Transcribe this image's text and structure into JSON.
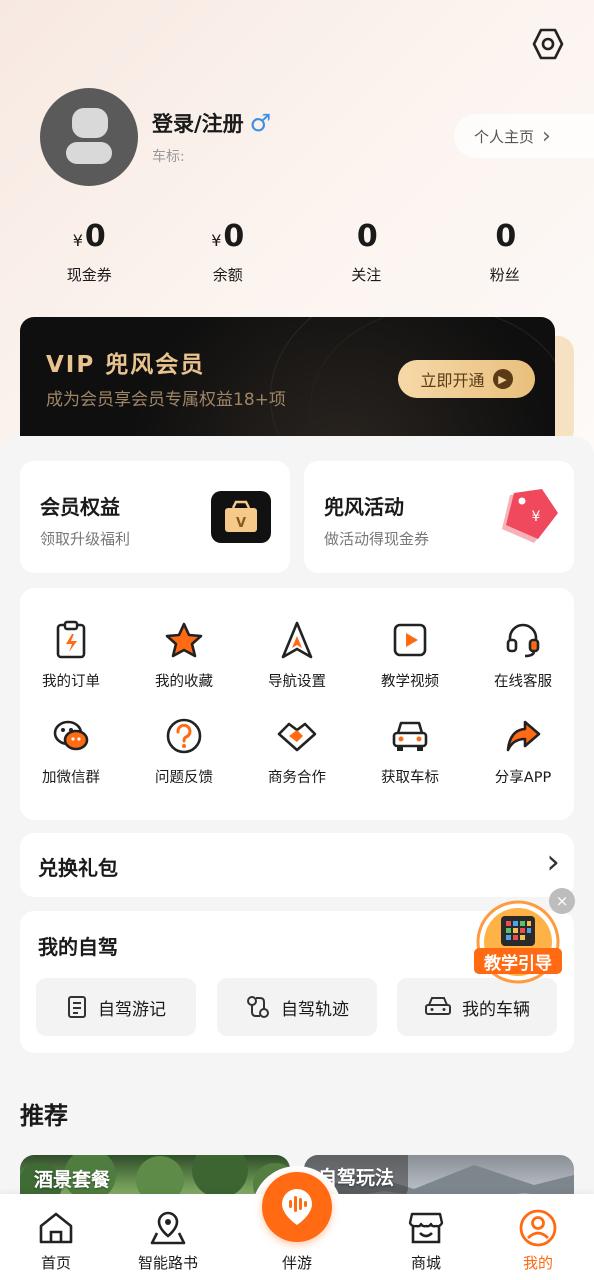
{
  "profile": {
    "login_label": "登录/注册",
    "gender_symbol": "♂",
    "car_badge_label": "车标:",
    "homepage_label": "个人主页",
    "homepage_arrow": "›"
  },
  "stats": [
    {
      "currency": "¥",
      "value": "0",
      "label": "现金券"
    },
    {
      "currency": "¥",
      "value": "0",
      "label": "余额"
    },
    {
      "currency": "",
      "value": "0",
      "label": "关注"
    },
    {
      "currency": "",
      "value": "0",
      "label": "粉丝"
    }
  ],
  "vip": {
    "title": "VIP 兜风会员",
    "subtitle": "成为会员享会员专属权益18+项",
    "button": "立即开通"
  },
  "feature_cards": [
    {
      "title": "会员权益",
      "subtitle": "领取升级福利"
    },
    {
      "title": "兜风活动",
      "subtitle": "做活动得现金券"
    }
  ],
  "tools": [
    {
      "label": "我的订单",
      "icon": "order-icon"
    },
    {
      "label": "我的收藏",
      "icon": "star-icon"
    },
    {
      "label": "导航设置",
      "icon": "navigation-icon"
    },
    {
      "label": "教学视频",
      "icon": "video-icon"
    },
    {
      "label": "在线客服",
      "icon": "headset-icon"
    },
    {
      "label": "加微信群",
      "icon": "wechat-icon"
    },
    {
      "label": "问题反馈",
      "icon": "question-icon"
    },
    {
      "label": "商务合作",
      "icon": "handshake-icon"
    },
    {
      "label": "获取车标",
      "icon": "car-icon"
    },
    {
      "label": "分享APP",
      "icon": "share-icon"
    }
  ],
  "exchange": {
    "label": "兑换礼包",
    "arrow": "›"
  },
  "self_drive": {
    "title": "我的自驾",
    "buttons": [
      {
        "label": "自驾游记",
        "icon": "journal-icon"
      },
      {
        "label": "自驾轨迹",
        "icon": "track-icon"
      },
      {
        "label": "我的车辆",
        "icon": "vehicle-icon"
      }
    ]
  },
  "floating_guide": {
    "label": "教学引导",
    "close": "×"
  },
  "recommend": {
    "title": "推荐",
    "cards": [
      {
        "label": "酒景套餐"
      },
      {
        "label": "自驾玩法"
      }
    ]
  },
  "tabbar": [
    {
      "label": "首页",
      "icon": "home-icon"
    },
    {
      "label": "智能路书",
      "icon": "map-pin-icon"
    },
    {
      "label": "伴游",
      "icon": "voice-icon"
    },
    {
      "label": "商城",
      "icon": "store-icon"
    },
    {
      "label": "我的",
      "icon": "user-icon"
    }
  ],
  "colors": {
    "accent": "#ff6a13",
    "vip_gold": "#e9c48f",
    "gender_blue": "#3b8fe6"
  }
}
